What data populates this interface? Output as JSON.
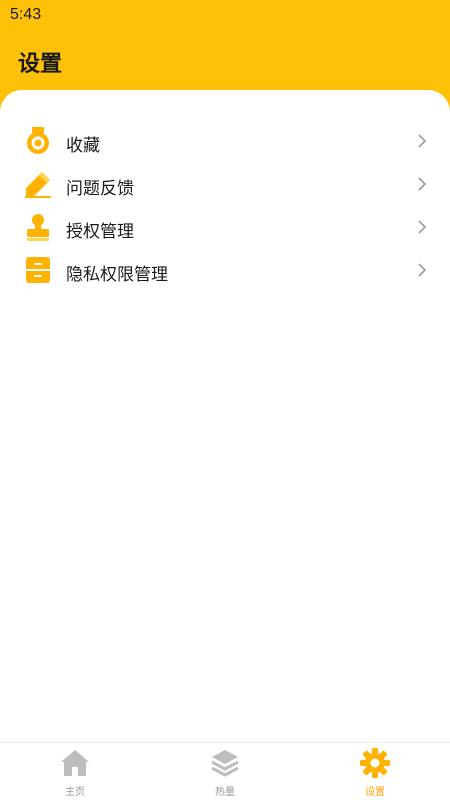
{
  "status_bar": {
    "time": "5:43"
  },
  "header": {
    "title": "设置"
  },
  "menu": {
    "items": [
      {
        "label": "收藏",
        "icon": "medal-icon"
      },
      {
        "label": "问题反馈",
        "icon": "pencil-icon"
      },
      {
        "label": "授权管理",
        "icon": "stamp-icon"
      },
      {
        "label": "隐私权限管理",
        "icon": "cabinet-icon"
      }
    ]
  },
  "tab_bar": {
    "tabs": [
      {
        "label": "主页",
        "icon": "home-icon",
        "active": false
      },
      {
        "label": "热量",
        "icon": "layers-icon",
        "active": false
      },
      {
        "label": "设置",
        "icon": "gear-icon",
        "active": true
      }
    ]
  },
  "colors": {
    "accent": "#FFC107",
    "icon": "#FFB300",
    "tab_inactive": "#BDBDBD",
    "tab_active": "#FFA000"
  }
}
